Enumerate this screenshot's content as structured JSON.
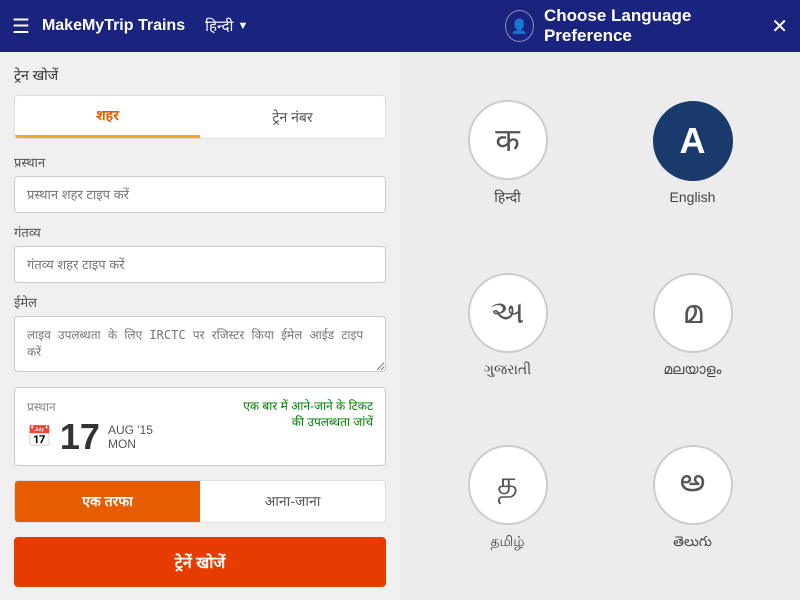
{
  "header": {
    "menu_icon": "☰",
    "logo": "MakeMyTrip Trains",
    "lang_label": "हिन्दी",
    "lang_arrow": "▼",
    "avatar_icon": "👤",
    "title": "Choose Language Preference",
    "close_icon": "✕"
  },
  "left": {
    "section_title": "ट्रेन खोजें",
    "tab_city": "शहर",
    "tab_train_number": "ट्रेन नंबर",
    "from_label": "प्रस्थान",
    "from_placeholder": "प्रस्थान शहर टाइप करें",
    "to_label": "गंतव्य",
    "to_placeholder": "गंतव्य शहर टाइप करें",
    "email_label": "ईमेल",
    "email_placeholder": "लाइव उपलब्धता के लिए IRCTC पर रजिस्टर किया ईमेल आईड टाइप करें",
    "date_label": "प्रस्थान",
    "date_number": "17",
    "date_month": "AUG '15",
    "date_day": "MON",
    "round_trip_text": "एक बार में आने-जाने के टिकट\nकी उपलब्धता जांचें",
    "one_way_label": "एक तरफा",
    "round_trip_label": "आना-जाना",
    "search_btn_label": "ट्रेनें खोजें"
  },
  "languages": [
    {
      "id": "hindi",
      "symbol": "क",
      "name": "हिन्दी",
      "selected": false
    },
    {
      "id": "english",
      "symbol": "A",
      "name": "English",
      "selected": true
    },
    {
      "id": "gujarati",
      "symbol": "અ",
      "name": "ગુજરાતી",
      "selected": false
    },
    {
      "id": "malayalam",
      "symbol": "മ",
      "name": "മലയാളം",
      "selected": false
    },
    {
      "id": "tamil",
      "symbol": "த",
      "name": "தமிழ்",
      "selected": false
    },
    {
      "id": "telugu",
      "symbol": "అ",
      "name": "తెలుగు",
      "selected": false
    }
  ]
}
